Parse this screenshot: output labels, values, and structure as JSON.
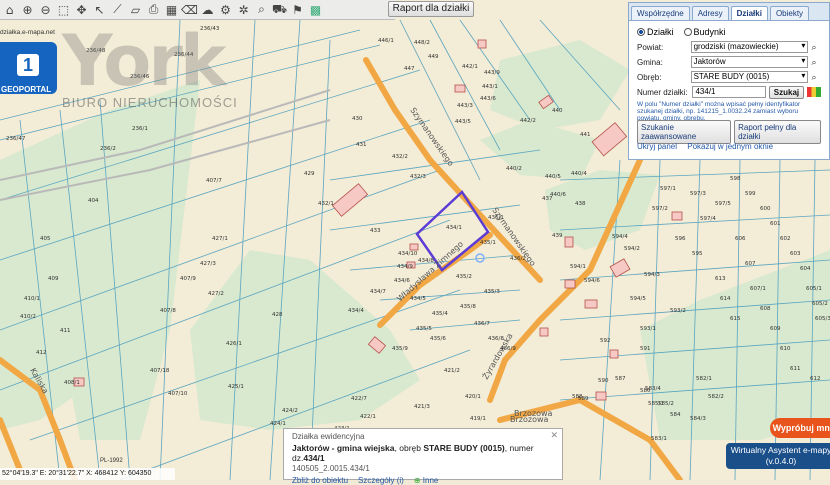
{
  "toolbar": {
    "icons": [
      "home-icon",
      "zoom-in-icon",
      "zoom-out-icon",
      "zoom-extent-icon",
      "pan-icon",
      "select-icon",
      "measure-icon",
      "ruler-icon",
      "print-icon",
      "table-icon",
      "erase-icon",
      "cloud-icon",
      "share-icon",
      "settings-icon",
      "search-icon",
      "shopping-cart-icon",
      "flag-icon",
      "layers-icon"
    ],
    "report_label": "Raport dla działki"
  },
  "panel": {
    "tabs": [
      "Współrzędne",
      "Adresy",
      "Działki",
      "Obiekty"
    ],
    "active_tab": "Działki",
    "radio_dzialki": "Działki",
    "radio_budynki": "Budynki",
    "powiat_label": "Powiat:",
    "powiat_value": "grodziski (mazowieckie)",
    "gmina_label": "Gmina:",
    "gmina_value": "Jaktorów",
    "obreb_label": "Obręb:",
    "obreb_value": "STARE BUDY (0015)",
    "numer_label": "Numer działki:",
    "numer_value": "434/1",
    "search_label": "Szukaj",
    "hint": "W polu \"Numer działki\" można wpisać pełny identyfikator szukanej działki, np. 141215_1.0032.24 zamiast wyboru powiatu, gminy, obrębu.",
    "advanced_label": "Szukanie zaawansowane",
    "full_report_label": "Raport pełny dla działki",
    "hide_panel": "Ukryj panel",
    "show_window": "Pokazuj w jednym oknie"
  },
  "info": {
    "title": "Działka ewidencyjna",
    "line_bold": "Jaktorów - gmina wiejska",
    "line_mid": ", obręb ",
    "line_obreb": "STARE BUDY (0015)",
    "line_nr": ", numer dz.",
    "line_nr_val": "434/1",
    "id": "140505_2.0015.434/1",
    "zoom_label": "Zbliż do obiektu",
    "details_label": "Szczegóły (i)",
    "more_label": "Inne",
    "close": "✕"
  },
  "coords": "52°04'19.3\"  E: 20°31'22.7\"  X: 468412  Y: 604350",
  "scale_label": "PL-1992",
  "geoportal": {
    "num": "1",
    "label": "GEOPORTAL",
    "url": "działka.e-mapa.net"
  },
  "watermark": {
    "big": "York",
    "small": "BIURO NIERUCHOMOŚCI"
  },
  "assistant": {
    "try": "Wypróbuj mnie",
    "title": "Wirtualny Asystent e-mapy",
    "version": "(v.0.4.0)"
  },
  "map": {
    "roads": [
      "Szymanowskiego",
      "Szymanowskiego",
      "Władysława Zimnego",
      "Żyrardowska",
      "Brzozowa",
      "Brzozowa",
      "Kaliska"
    ],
    "parcels": [
      "434/1",
      "433",
      "434/10",
      "434/9",
      "434/7",
      "434/6",
      "434/5",
      "434/8",
      "434/4",
      "435/2",
      "435/1",
      "435/3",
      "435/4",
      "435/5",
      "435/6",
      "435/8",
      "435/9",
      "436/7",
      "436/8",
      "436/9",
      "432/1",
      "432/2",
      "432/3",
      "430",
      "431",
      "429",
      "428",
      "427/1",
      "427/2",
      "427/3",
      "426/1",
      "425/1",
      "424/2",
      "424/1",
      "423/1",
      "422/1",
      "421/3",
      "422/7",
      "422/2",
      "421/2",
      "420/1",
      "419/1",
      "405",
      "404",
      "408/1",
      "407/18",
      "407/10",
      "407/7",
      "407/8",
      "407/9",
      "409",
      "410/1",
      "410/2",
      "411",
      "412",
      "236/47",
      "236/48",
      "236/46",
      "236/44",
      "236/43",
      "236/1",
      "236/2",
      "446/1",
      "447",
      "448/2",
      "449",
      "442/1",
      "443/3",
      "443/5",
      "443/6",
      "443/9",
      "443/1",
      "442/2",
      "441",
      "440",
      "440/4",
      "440/5",
      "440/6",
      "440/2",
      "439",
      "438",
      "437",
      "436/1",
      "436/2",
      "594/1",
      "594/2",
      "594/3",
      "594/4",
      "594/5",
      "594/6",
      "593/1",
      "593/2",
      "592",
      "591",
      "590",
      "589",
      "588",
      "587",
      "586",
      "585/1",
      "585/2",
      "584",
      "583/4",
      "583/1",
      "584/3",
      "582/1",
      "582/2",
      "597/1",
      "597/2",
      "597/3",
      "597/4",
      "597/5",
      "596",
      "595",
      "598",
      "599",
      "600",
      "601",
      "602",
      "603",
      "604",
      "605/1",
      "605/2",
      "605/3",
      "606",
      "607",
      "607/1",
      "608",
      "609",
      "610",
      "611",
      "612",
      "613",
      "614",
      "615"
    ]
  }
}
